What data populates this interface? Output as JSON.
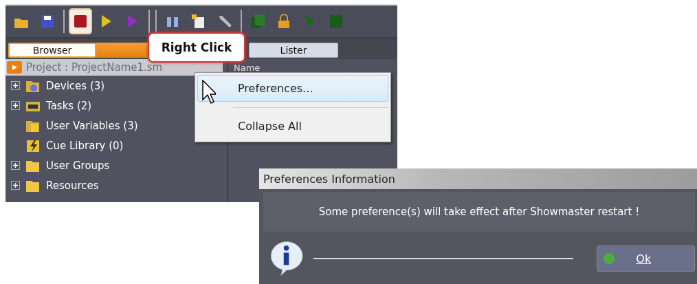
{
  "toolbar": [
    {
      "kind": "open",
      "selected": false
    },
    {
      "kind": "save",
      "selected": false
    },
    {
      "kind": "stop",
      "selected": true
    },
    {
      "kind": "run",
      "selected": false
    },
    {
      "kind": "run-alt",
      "selected": false
    },
    {
      "kind": "find",
      "selected": false
    },
    {
      "kind": "new",
      "selected": false
    },
    {
      "kind": "tool",
      "selected": false
    },
    {
      "kind": "pages",
      "selected": false
    },
    {
      "kind": "lock",
      "selected": false
    },
    {
      "kind": "play",
      "selected": false
    },
    {
      "kind": "halt",
      "selected": false
    }
  ],
  "tabs": [
    {
      "label": "Browser",
      "selected": true
    },
    {
      "label": "Lister",
      "selected": false
    }
  ],
  "project": "Project : ProjectName1.sm",
  "column_header": "Name",
  "tree": [
    {
      "label": "Devices (3)",
      "kind": "devices",
      "expandable": true
    },
    {
      "label": "Tasks (2)",
      "kind": "tasks",
      "expandable": true
    },
    {
      "label": "User Variables (3)",
      "kind": "variables",
      "expandable": false
    },
    {
      "label": "Cue Library (0)",
      "kind": "cue",
      "expandable": false
    },
    {
      "label": "User Groups",
      "kind": "folder",
      "expandable": true
    },
    {
      "label": "Resources",
      "kind": "folder",
      "expandable": true
    }
  ],
  "callout": "Right Click",
  "context_menu": [
    {
      "label": "Preferences...",
      "selected": true
    },
    {
      "label": "Collapse All",
      "selected": false
    }
  ],
  "dialog": {
    "title": "Preferences Information",
    "message": "Some preference(s) will take effect after Showmaster restart !",
    "button": "Ok"
  }
}
